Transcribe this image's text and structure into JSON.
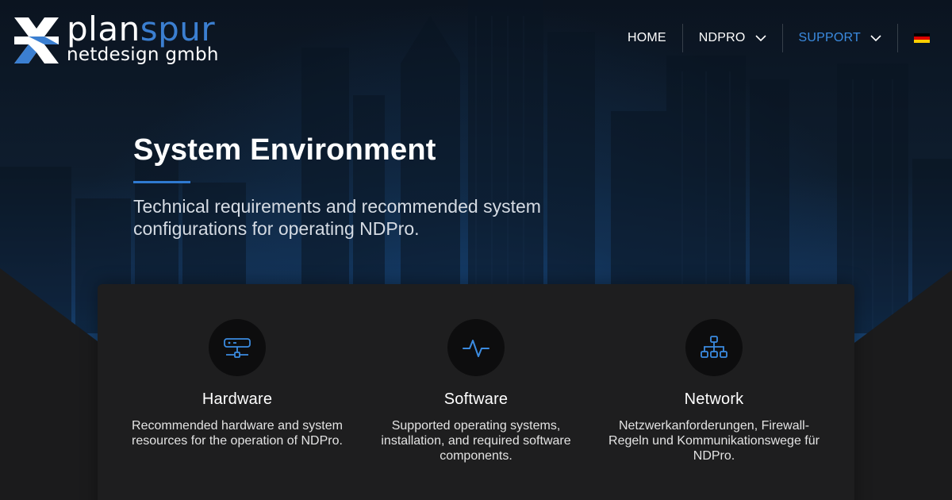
{
  "brand": {
    "name_part1": "plan",
    "name_part2": "spur",
    "subline": "netdesign gmbh",
    "accent": "#3b7fd1"
  },
  "nav": {
    "items": [
      {
        "label": "HOME",
        "has_dropdown": false,
        "active": false
      },
      {
        "label": "NDPRO",
        "has_dropdown": true,
        "active": false
      },
      {
        "label": "SUPPORT",
        "has_dropdown": true,
        "active": true
      }
    ],
    "language_icon": "german-flag-icon"
  },
  "hero": {
    "title": "System Environment",
    "subtitle": "Technical requirements and recommended system configurations for operating NDPro."
  },
  "features": [
    {
      "icon": "server-icon",
      "title": "Hardware",
      "description": "Recommended hardware and system resources for the operation of NDPro."
    },
    {
      "icon": "activity-pulse-icon",
      "title": "Software",
      "description": "Supported operating systems, installation, and required software components."
    },
    {
      "icon": "network-hierarchy-icon",
      "title": "Network",
      "description": "Netzwerkanforderungen, Firewall-Regeln und Kommunikationswege für NDPro."
    }
  ]
}
